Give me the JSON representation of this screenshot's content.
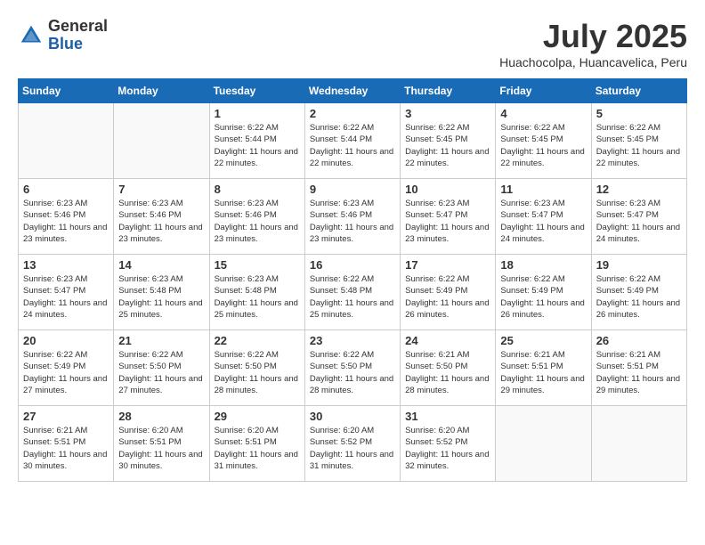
{
  "logo": {
    "general": "General",
    "blue": "Blue"
  },
  "title": "July 2025",
  "location": "Huachocolpa, Huancavelica, Peru",
  "days_of_week": [
    "Sunday",
    "Monday",
    "Tuesday",
    "Wednesday",
    "Thursday",
    "Friday",
    "Saturday"
  ],
  "weeks": [
    [
      {
        "day": "",
        "info": ""
      },
      {
        "day": "",
        "info": ""
      },
      {
        "day": "1",
        "info": "Sunrise: 6:22 AM\nSunset: 5:44 PM\nDaylight: 11 hours and 22 minutes."
      },
      {
        "day": "2",
        "info": "Sunrise: 6:22 AM\nSunset: 5:44 PM\nDaylight: 11 hours and 22 minutes."
      },
      {
        "day": "3",
        "info": "Sunrise: 6:22 AM\nSunset: 5:45 PM\nDaylight: 11 hours and 22 minutes."
      },
      {
        "day": "4",
        "info": "Sunrise: 6:22 AM\nSunset: 5:45 PM\nDaylight: 11 hours and 22 minutes."
      },
      {
        "day": "5",
        "info": "Sunrise: 6:22 AM\nSunset: 5:45 PM\nDaylight: 11 hours and 22 minutes."
      }
    ],
    [
      {
        "day": "6",
        "info": "Sunrise: 6:23 AM\nSunset: 5:46 PM\nDaylight: 11 hours and 23 minutes."
      },
      {
        "day": "7",
        "info": "Sunrise: 6:23 AM\nSunset: 5:46 PM\nDaylight: 11 hours and 23 minutes."
      },
      {
        "day": "8",
        "info": "Sunrise: 6:23 AM\nSunset: 5:46 PM\nDaylight: 11 hours and 23 minutes."
      },
      {
        "day": "9",
        "info": "Sunrise: 6:23 AM\nSunset: 5:46 PM\nDaylight: 11 hours and 23 minutes."
      },
      {
        "day": "10",
        "info": "Sunrise: 6:23 AM\nSunset: 5:47 PM\nDaylight: 11 hours and 23 minutes."
      },
      {
        "day": "11",
        "info": "Sunrise: 6:23 AM\nSunset: 5:47 PM\nDaylight: 11 hours and 24 minutes."
      },
      {
        "day": "12",
        "info": "Sunrise: 6:23 AM\nSunset: 5:47 PM\nDaylight: 11 hours and 24 minutes."
      }
    ],
    [
      {
        "day": "13",
        "info": "Sunrise: 6:23 AM\nSunset: 5:47 PM\nDaylight: 11 hours and 24 minutes."
      },
      {
        "day": "14",
        "info": "Sunrise: 6:23 AM\nSunset: 5:48 PM\nDaylight: 11 hours and 25 minutes."
      },
      {
        "day": "15",
        "info": "Sunrise: 6:23 AM\nSunset: 5:48 PM\nDaylight: 11 hours and 25 minutes."
      },
      {
        "day": "16",
        "info": "Sunrise: 6:22 AM\nSunset: 5:48 PM\nDaylight: 11 hours and 25 minutes."
      },
      {
        "day": "17",
        "info": "Sunrise: 6:22 AM\nSunset: 5:49 PM\nDaylight: 11 hours and 26 minutes."
      },
      {
        "day": "18",
        "info": "Sunrise: 6:22 AM\nSunset: 5:49 PM\nDaylight: 11 hours and 26 minutes."
      },
      {
        "day": "19",
        "info": "Sunrise: 6:22 AM\nSunset: 5:49 PM\nDaylight: 11 hours and 26 minutes."
      }
    ],
    [
      {
        "day": "20",
        "info": "Sunrise: 6:22 AM\nSunset: 5:49 PM\nDaylight: 11 hours and 27 minutes."
      },
      {
        "day": "21",
        "info": "Sunrise: 6:22 AM\nSunset: 5:50 PM\nDaylight: 11 hours and 27 minutes."
      },
      {
        "day": "22",
        "info": "Sunrise: 6:22 AM\nSunset: 5:50 PM\nDaylight: 11 hours and 28 minutes."
      },
      {
        "day": "23",
        "info": "Sunrise: 6:22 AM\nSunset: 5:50 PM\nDaylight: 11 hours and 28 minutes."
      },
      {
        "day": "24",
        "info": "Sunrise: 6:21 AM\nSunset: 5:50 PM\nDaylight: 11 hours and 28 minutes."
      },
      {
        "day": "25",
        "info": "Sunrise: 6:21 AM\nSunset: 5:51 PM\nDaylight: 11 hours and 29 minutes."
      },
      {
        "day": "26",
        "info": "Sunrise: 6:21 AM\nSunset: 5:51 PM\nDaylight: 11 hours and 29 minutes."
      }
    ],
    [
      {
        "day": "27",
        "info": "Sunrise: 6:21 AM\nSunset: 5:51 PM\nDaylight: 11 hours and 30 minutes."
      },
      {
        "day": "28",
        "info": "Sunrise: 6:20 AM\nSunset: 5:51 PM\nDaylight: 11 hours and 30 minutes."
      },
      {
        "day": "29",
        "info": "Sunrise: 6:20 AM\nSunset: 5:51 PM\nDaylight: 11 hours and 31 minutes."
      },
      {
        "day": "30",
        "info": "Sunrise: 6:20 AM\nSunset: 5:52 PM\nDaylight: 11 hours and 31 minutes."
      },
      {
        "day": "31",
        "info": "Sunrise: 6:20 AM\nSunset: 5:52 PM\nDaylight: 11 hours and 32 minutes."
      },
      {
        "day": "",
        "info": ""
      },
      {
        "day": "",
        "info": ""
      }
    ]
  ]
}
